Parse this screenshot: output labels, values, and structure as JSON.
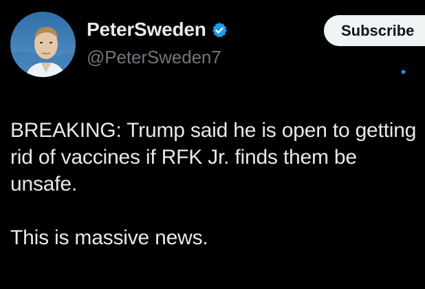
{
  "author": {
    "display_name": "PeterSweden",
    "handle": "@PeterSweden7",
    "verified_icon": "verified-badge-icon"
  },
  "subscribe_label": "Subscribe",
  "tweet": {
    "paragraph_1": "BREAKING: Trump said he is open to getting rid of vaccines if RFK Jr. finds them be unsafe.",
    "paragraph_2": "This is massive news."
  },
  "colors": {
    "background": "#000000",
    "text_primary": "#e7e9ea",
    "text_secondary": "#71767b",
    "verified_blue": "#1d9bf0",
    "subscribe_bg": "#eff3f4"
  }
}
